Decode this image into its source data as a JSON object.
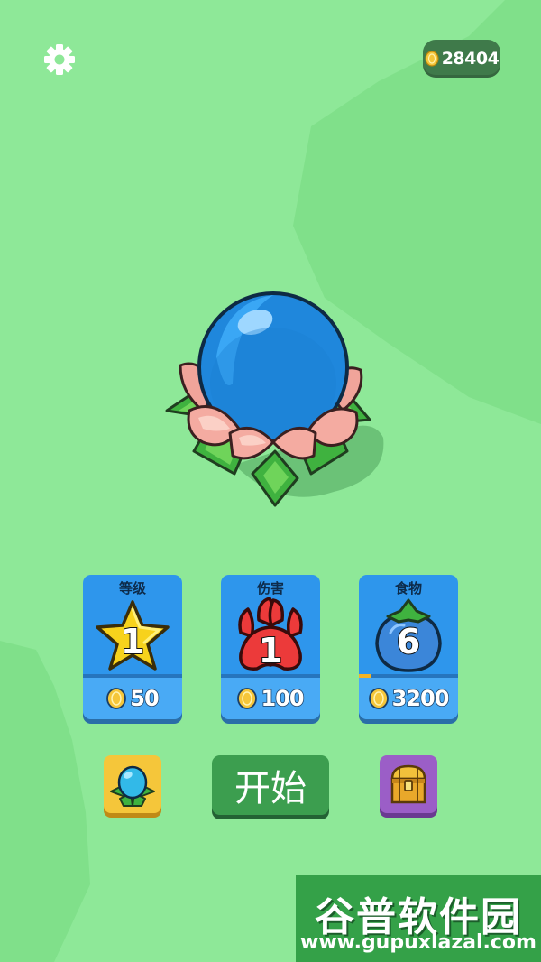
{
  "header": {
    "coins": "28404",
    "settings_icon": "gear-icon",
    "coin_icon": "coin-icon"
  },
  "pet": {
    "icon": "blue-egg-in-lotus-icon"
  },
  "upgrades": [
    {
      "title": "等级",
      "value": "1",
      "icon": "star-icon",
      "price": "50"
    },
    {
      "title": "伤害",
      "value": "1",
      "icon": "paw-icon",
      "price": "100"
    },
    {
      "title": "食物",
      "value": "6",
      "icon": "berry-icon",
      "price": "3200",
      "progress": 0.13
    }
  ],
  "bottom_bar": {
    "egg_button_icon": "egg-icon",
    "start_label": "开始",
    "chest_button_icon": "treasure-chest-icon"
  },
  "watermark": {
    "title": "谷普软件园",
    "url": "www.gupuxlazal.com"
  },
  "colors": {
    "background": "#8ee898",
    "card_blue": "#2e96ec",
    "start_green": "#3c9e4f",
    "coin_gold": "#f5c63a"
  }
}
